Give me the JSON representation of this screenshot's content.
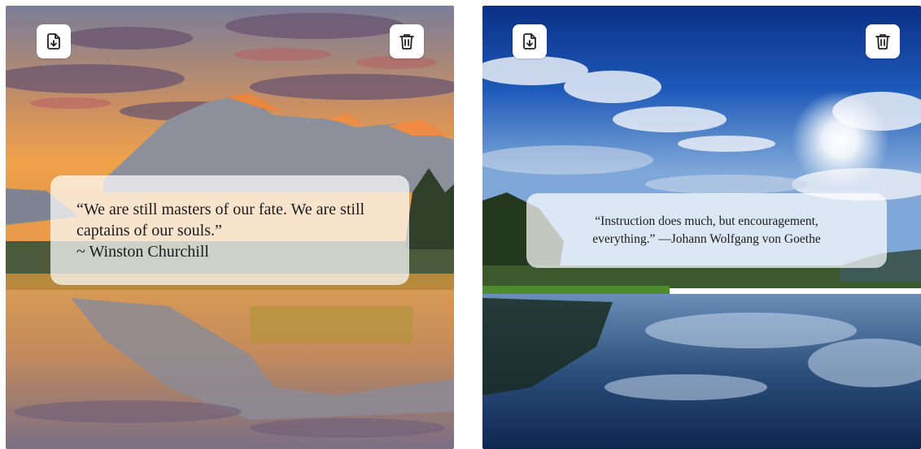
{
  "cards": [
    {
      "quote_lines": [
        "“We are still masters of our fate. We are still",
        "captains of our souls.”",
        "~ Winston Churchill"
      ],
      "background": "mountain-lake-sunset"
    },
    {
      "quote_lines": [
        "“Instruction does much, but encouragement,",
        "everything.” —Johann Wolfgang von Goethe"
      ],
      "background": "blue-sky-river"
    }
  ],
  "icons": {
    "download": "file-download-icon",
    "delete": "trash-icon"
  },
  "colors": {
    "button_bg": "#ffffff",
    "icon_stroke": "#222222",
    "quote_text": "#1c1c1c"
  }
}
